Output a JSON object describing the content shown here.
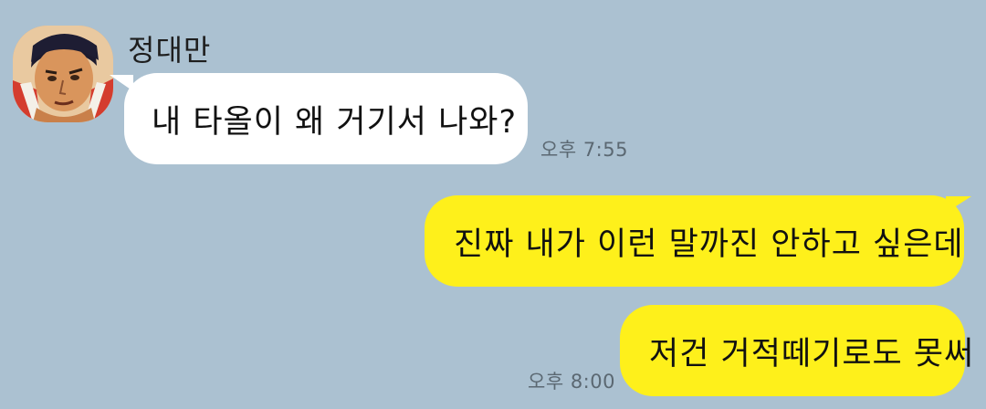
{
  "messages": [
    {
      "sender": "정대만",
      "avatar_icon": "profile-avatar",
      "text": "내 타올이 왜 거기서 나와?",
      "time": "오후 7:55",
      "direction": "incoming",
      "bubble_color": "#ffffff"
    },
    {
      "text": "진짜 내가 이런 말까진 안하고 싶은데",
      "direction": "outgoing",
      "bubble_color": "#fef01b"
    },
    {
      "text": "저건 거적떼기로도 못써",
      "time": "오후 8:00",
      "direction": "outgoing",
      "bubble_color": "#fef01b"
    }
  ],
  "colors": {
    "background": "#abc1d1",
    "incoming_bubble": "#ffffff",
    "outgoing_bubble": "#fef01b",
    "timestamp": "#5b6872"
  }
}
